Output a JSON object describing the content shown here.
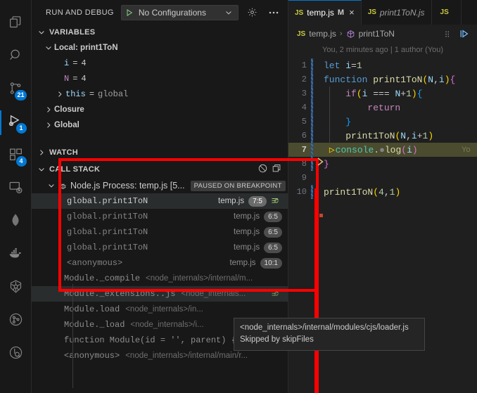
{
  "activity_bar": {
    "items": [
      {
        "name": "explorer",
        "icon": "files-icon",
        "badge": null,
        "active": false
      },
      {
        "name": "search",
        "icon": "search-icon",
        "badge": null,
        "active": false
      },
      {
        "name": "source-control",
        "icon": "source-control-icon",
        "badge": "21",
        "active": false
      },
      {
        "name": "run-and-debug",
        "icon": "run-debug-icon",
        "badge": "1",
        "active": true
      },
      {
        "name": "extensions",
        "icon": "extensions-icon",
        "badge": "4",
        "active": false
      },
      {
        "name": "remote-explorer",
        "icon": "remote-explorer-icon",
        "badge": null,
        "active": false
      },
      {
        "name": "mongodb",
        "icon": "mongodb-leaf-icon",
        "badge": null,
        "active": false
      },
      {
        "name": "docker",
        "icon": "docker-whale-icon",
        "badge": null,
        "active": false
      },
      {
        "name": "kubernetes",
        "icon": "kubernetes-helm-icon",
        "badge": null,
        "active": false
      },
      {
        "name": "test-explorer",
        "icon": "test-circle-icon",
        "badge": null,
        "active": false
      },
      {
        "name": "azure",
        "icon": "azure-circle-icon",
        "badge": null,
        "active": false
      }
    ]
  },
  "sidebar": {
    "title": "RUN AND DEBUG",
    "config_label": "No Configurations",
    "play_icon": "play-icon",
    "chevron_icon": "chevron-down-icon",
    "gear_icon": "gear-icon",
    "more_icon": "more-actions-icon",
    "variables": {
      "header": "VARIABLES",
      "expanded": true,
      "scopes": [
        {
          "label": "Local: print1ToN",
          "expanded": true,
          "vars": [
            {
              "name": "i",
              "value": "4",
              "expandable": false
            },
            {
              "name": "N",
              "value": "4",
              "expandable": false
            },
            {
              "name": "this",
              "value": "global",
              "expandable": true
            }
          ]
        },
        {
          "label": "Closure",
          "expanded": false,
          "vars": []
        },
        {
          "label": "Global",
          "expanded": false,
          "vars": []
        }
      ]
    },
    "watch": {
      "header": "WATCH",
      "expanded": false
    },
    "call_stack": {
      "header": "CALL STACK",
      "expanded": true,
      "actions": [
        {
          "name": "pause-on-exception-icon",
          "glyph": "stop-circle-slash-icon"
        },
        {
          "name": "collapse-all-icon",
          "glyph": "copy-window-icon"
        }
      ],
      "process": {
        "label": "Node.js Process: temp.js [5...",
        "badge": "PAUSED ON BREAKPOINT",
        "icon": "debug-bug-icon"
      },
      "frames": [
        {
          "fn": "global.print1ToN",
          "file": "temp.js",
          "pos": "7:5",
          "selected": true,
          "restart": true
        },
        {
          "fn": "global.print1ToN",
          "file": "temp.js",
          "pos": "6:5",
          "selected": false,
          "restart": false
        },
        {
          "fn": "global.print1ToN",
          "file": "temp.js",
          "pos": "6:5",
          "selected": false,
          "restart": false
        },
        {
          "fn": "global.print1ToN",
          "file": "temp.js",
          "pos": "6:5",
          "selected": false,
          "restart": false
        },
        {
          "fn": "<anonymous>",
          "file": "temp.js",
          "pos": "10:1",
          "selected": false,
          "restart": false
        }
      ],
      "internal_frames": [
        {
          "fn": "Module._compile",
          "path": "<node_internals>/internal/m...",
          "highlighted": false,
          "restart": false
        },
        {
          "fn": "Module._extensions..js",
          "path": "<node_internals...",
          "highlighted": true,
          "restart": true
        },
        {
          "fn": "Module.load",
          "path": "<node_internals>/in...",
          "highlighted": false,
          "restart": false
        },
        {
          "fn": "Module._load",
          "path": "<node_internals>/i...",
          "highlighted": false,
          "restart": false
        },
        {
          "fn": "function Module(id = '', parent) {.executeUse",
          "path": "",
          "highlighted": false,
          "restart": false
        },
        {
          "fn": "<anonymous>",
          "path": "<node_internals>/internal/main/r...",
          "highlighted": false,
          "restart": false
        }
      ]
    },
    "tooltip": {
      "line1": "<node_internals>/internal/modules/cjs/loader.js",
      "line2": "Skipped by skipFiles"
    },
    "annotation": {
      "color": "#fe0000",
      "arrow_icon": "debug-step-arrow-icon"
    }
  },
  "editor": {
    "tabs": [
      {
        "label": "temp.js",
        "icon": "js-file-icon",
        "modified": "M",
        "close": "×",
        "active": true,
        "preview": false
      },
      {
        "label": "print1ToN.js",
        "icon": "js-file-icon",
        "modified": "",
        "close": "",
        "active": false,
        "preview": true
      },
      {
        "label": "",
        "icon": "js-file-icon",
        "modified": "",
        "close": "",
        "active": false,
        "preview": false
      }
    ],
    "breadcrumb": {
      "file_icon": "js-file-icon",
      "file": "temp.js",
      "separator": "›",
      "symbol_icon": "symbol-method-icon",
      "symbol": "print1ToN",
      "actions": [
        {
          "name": "editor-actions-icon",
          "glyph": "grid-dots-icon"
        },
        {
          "name": "run-and-debug-editor-icon",
          "glyph": "run-play-icon"
        }
      ]
    },
    "blame": "You, 2 minutes ago | 1 author (You)",
    "inline_blame": "Yo",
    "lines": [
      {
        "n": "1",
        "dirty": true,
        "indent": false,
        "highlight": false,
        "breakpoint": false
      },
      {
        "n": "2",
        "dirty": true,
        "indent": false,
        "highlight": false,
        "breakpoint": false
      },
      {
        "n": "3",
        "dirty": true,
        "indent": true,
        "highlight": false,
        "breakpoint": false
      },
      {
        "n": "4",
        "dirty": true,
        "indent": true,
        "highlight": false,
        "breakpoint": false
      },
      {
        "n": "5",
        "dirty": true,
        "indent": true,
        "highlight": false,
        "breakpoint": false
      },
      {
        "n": "6",
        "dirty": true,
        "indent": true,
        "highlight": false,
        "breakpoint": false
      },
      {
        "n": "7",
        "dirty": true,
        "indent": true,
        "highlight": true,
        "breakpoint": true
      },
      {
        "n": "8",
        "dirty": true,
        "indent": false,
        "highlight": false,
        "breakpoint": false
      },
      {
        "n": "9",
        "dirty": false,
        "indent": false,
        "highlight": false,
        "breakpoint": false
      },
      {
        "n": "10",
        "dirty": true,
        "indent": false,
        "highlight": false,
        "breakpoint": false
      }
    ],
    "source": [
      "let i=1",
      "function print1ToN(N,i){",
      "    if(i === N+1){",
      "        return",
      "    }",
      "    print1ToN(N,i+1)",
      "    console.log(i)",
      "}",
      "",
      "print1ToN(4,1)"
    ]
  },
  "colors": {
    "accent": "#0078d4",
    "annotation": "#fe0000",
    "breakpoint_highlight": "#4b4b2f",
    "badge": "#0078d4",
    "editor_bg": "#1f1f1f",
    "sidebar_bg": "#181818"
  }
}
